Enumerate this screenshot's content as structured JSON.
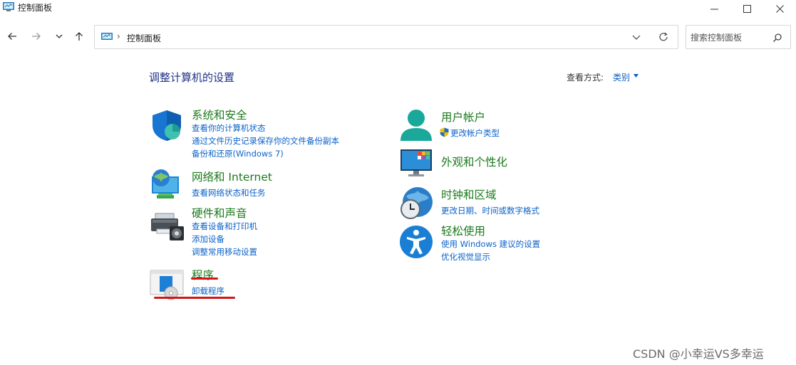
{
  "window": {
    "title": "控制面板",
    "app_icon": "control-panel-icon"
  },
  "nav": {
    "back_icon": "back-arrow-icon",
    "forward_icon": "forward-arrow-icon",
    "recent_icon": "chevron-down-icon",
    "up_icon": "up-arrow-icon",
    "address_separator": "›",
    "address_text": "控制面板",
    "search_placeholder": "搜索控制面板"
  },
  "header": {
    "title": "调整计算机的设置",
    "view_by_label": "查看方式:",
    "view_by_value": "类别"
  },
  "categories": {
    "system_security": {
      "title": "系统和安全",
      "icon": "shield-icon",
      "links": [
        "查看你的计算机状态",
        "通过文件历史记录保存你的文件备份副本",
        "备份和还原(Windows 7)"
      ]
    },
    "network": {
      "title": "网络和 Internet",
      "icon": "network-globe-icon",
      "links": [
        "查看网络状态和任务"
      ]
    },
    "hardware": {
      "title": "硬件和声音",
      "icon": "printer-speaker-icon",
      "links": [
        "查看设备和打印机",
        "添加设备",
        "调整常用移动设置"
      ]
    },
    "programs": {
      "title": "程序",
      "icon": "programs-disc-icon",
      "links": [
        "卸载程序"
      ]
    },
    "user_accounts": {
      "title": "用户帐户",
      "icon": "user-icon",
      "links": [
        "更改帐户类型"
      ]
    },
    "appearance": {
      "title": "外观和个性化",
      "icon": "monitor-colors-icon",
      "links": []
    },
    "clock_region": {
      "title": "时钟和区域",
      "icon": "clock-globe-icon",
      "links": [
        "更改日期、时间或数字格式"
      ]
    },
    "ease_access": {
      "title": "轻松使用",
      "icon": "accessibility-icon",
      "links": [
        "使用 Windows 建议的设置",
        "优化视觉显示"
      ]
    }
  },
  "colors": {
    "category_title": "#1b7a1b",
    "link": "#0b63c9",
    "header": "#1e3287",
    "annotation": "#d01818"
  },
  "watermark": "CSDN @小幸运VS多幸运"
}
